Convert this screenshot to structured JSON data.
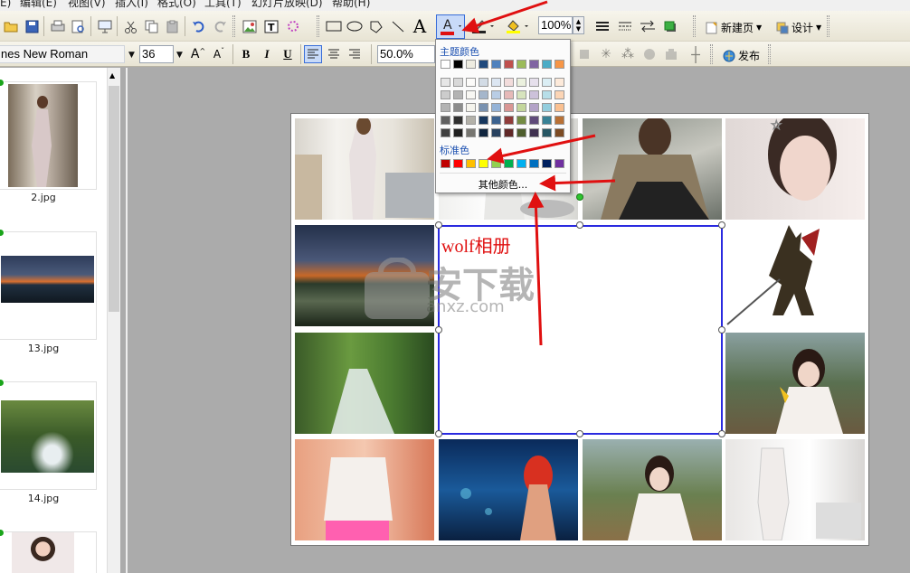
{
  "menu": [
    "E)",
    "编辑(E)",
    "视图(V)",
    "插入(I)",
    "格式(O)",
    "工具(T)",
    "幻灯片放映(D)",
    "帮助(H)"
  ],
  "toolbar": {
    "zoom": "100%",
    "new_page_label": "新建页",
    "design_label": "设计",
    "publish_label": "发布"
  },
  "format_bar": {
    "font_name": "nes New Roman",
    "font_size": "36",
    "bold": "B",
    "italic": "I",
    "underline": "U",
    "percent": "50.0%"
  },
  "thumbnails": [
    {
      "label": "2.jpg"
    },
    {
      "label": "13.jpg"
    },
    {
      "label": "14.jpg"
    },
    {
      "label": ""
    }
  ],
  "slide": {
    "title_text": "wolf相册",
    "watermark_text": "安下载",
    "watermark_sub": "anxz.com"
  },
  "color_menu": {
    "theme_header": "主题颜色",
    "standard_header": "标准色",
    "more_colors": "其他颜色...",
    "theme_row": [
      "#ffffff",
      "#000000",
      "#eeece1",
      "#1f497d",
      "#4f81bd",
      "#c0504d",
      "#9bbb59",
      "#8064a2",
      "#4bacc6",
      "#f79646"
    ],
    "standard_colors": [
      "#c00000",
      "#ff0000",
      "#ffc000",
      "#ffff00",
      "#92d050",
      "#00b050",
      "#00b0f0",
      "#0070c0",
      "#002060",
      "#7030a0"
    ]
  },
  "colors": {
    "accent_red": "#e01010",
    "selection_blue": "#2a2ae0",
    "popup_header": "#1a4fb0"
  }
}
